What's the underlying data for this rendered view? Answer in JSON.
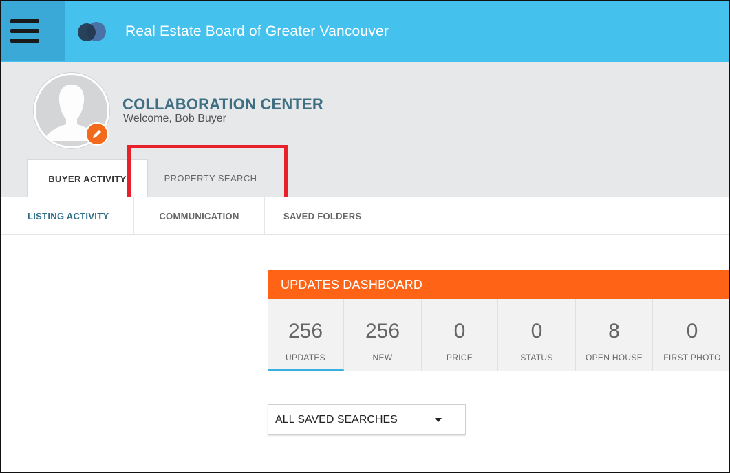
{
  "app": {
    "title": "Real Estate Board of Greater Vancouver"
  },
  "header": {
    "title": "COLLABORATION CENTER",
    "welcome": "Welcome, Bob Buyer"
  },
  "tabs": [
    {
      "label": "BUYER ACTIVITY",
      "active": true
    },
    {
      "label": "PROPERTY SEARCH",
      "active": false
    }
  ],
  "subtabs": [
    {
      "label": "LISTING ACTIVITY",
      "active": true
    },
    {
      "label": "COMMUNICATION",
      "active": false
    },
    {
      "label": "SAVED FOLDERS",
      "active": false
    }
  ],
  "dashboard": {
    "title": "UPDATES DASHBOARD",
    "stats": [
      {
        "value": "256",
        "label": "UPDATES",
        "active": true
      },
      {
        "value": "256",
        "label": "NEW"
      },
      {
        "value": "0",
        "label": "PRICE"
      },
      {
        "value": "0",
        "label": "STATUS"
      },
      {
        "value": "8",
        "label": "OPEN HOUSE"
      },
      {
        "value": "0",
        "label": "FIRST PHOTO"
      }
    ]
  },
  "filter": {
    "selected": "ALL SAVED SEARCHES"
  },
  "icons": {
    "menu": "hamburger-menu-icon",
    "logo": "overlapping-circles-logo",
    "edit": "pencil-icon",
    "dropdown": "caret-down-icon"
  },
  "colors": {
    "topbar": "#45c1ee",
    "accent_orange": "#ff6316",
    "tab_text_active": "#2f6d8c",
    "highlight": "#e8202a"
  }
}
